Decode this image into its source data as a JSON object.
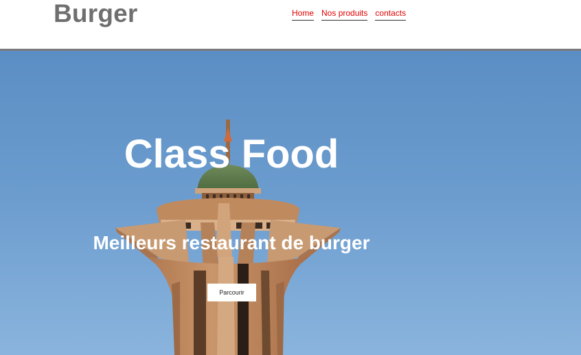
{
  "header": {
    "brand": "Burger",
    "nav": [
      {
        "label": "Home"
      },
      {
        "label": "Nos produits"
      },
      {
        "label": "contacts"
      }
    ]
  },
  "hero": {
    "title": "Class Food",
    "subtitle": "Meilleurs restaurant de burger",
    "button_label": "Parcourir",
    "background": "photo of a tower monument against a blue sky"
  },
  "colors": {
    "nav_link": "#e00000",
    "brand": "#6f6f6f",
    "header_border": "#7a7a7a",
    "sky": "#6a9bcd"
  }
}
